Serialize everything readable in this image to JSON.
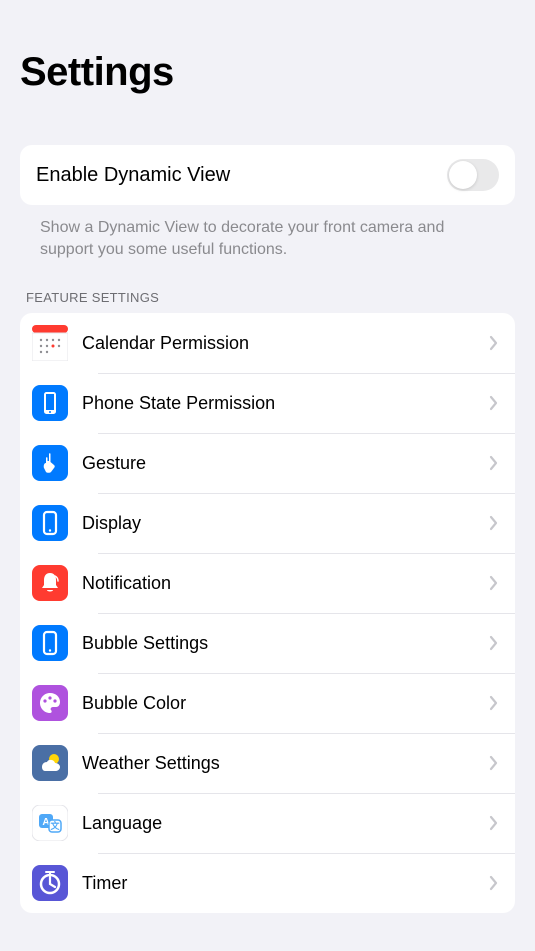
{
  "title": "Settings",
  "toggle": {
    "label": "Enable Dynamic View",
    "enabled": false
  },
  "description": "Show a Dynamic View to decorate your front camera and support you some useful functions.",
  "section_header": "FEATURE SETTINGS",
  "features": [
    {
      "label": "Calendar Permission",
      "icon": "calendar",
      "icon_bg": "#FF3B30",
      "icon_style": "calendar"
    },
    {
      "label": "Phone State Permission",
      "icon": "phone-state",
      "icon_bg": "#007AFF",
      "icon_style": "phone-solid"
    },
    {
      "label": "Gesture",
      "icon": "gesture",
      "icon_bg": "#007AFF",
      "icon_style": "hand"
    },
    {
      "label": "Display",
      "icon": "display",
      "icon_bg": "#007AFF",
      "icon_style": "phone-outline"
    },
    {
      "label": "Notification",
      "icon": "notification",
      "icon_bg": "#FF3B30",
      "icon_style": "bell"
    },
    {
      "label": "Bubble Settings",
      "icon": "bubble",
      "icon_bg": "#007AFF",
      "icon_style": "phone-outline"
    },
    {
      "label": "Bubble Color",
      "icon": "palette",
      "icon_bg": "#AF52DE",
      "icon_style": "palette"
    },
    {
      "label": "Weather Settings",
      "icon": "weather",
      "icon_bg": "#4A6FA5",
      "icon_style": "weather"
    },
    {
      "label": "Language",
      "icon": "language",
      "icon_bg": "#FFFFFF",
      "icon_style": "language"
    },
    {
      "label": "Timer",
      "icon": "timer",
      "icon_bg": "#5856D6",
      "icon_style": "timer"
    }
  ]
}
